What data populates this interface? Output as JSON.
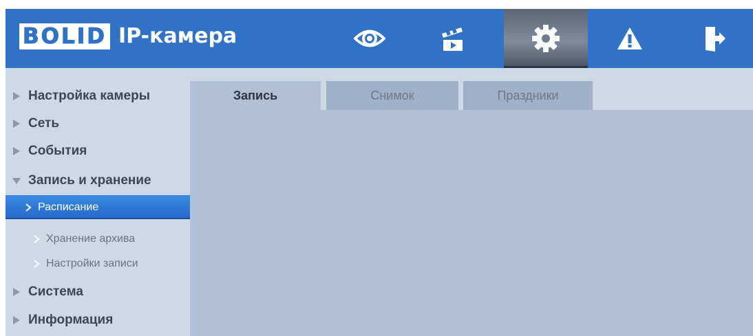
{
  "header": {
    "logo": "BOLID",
    "product": "IP-камера",
    "nav": [
      {
        "icon": "eye-icon",
        "label": "Просмотр"
      },
      {
        "icon": "clapperboard-icon",
        "label": "Воспроизведение"
      },
      {
        "icon": "gear-icon",
        "label": "Настройки",
        "active": true
      },
      {
        "icon": "warning-icon",
        "label": "Тревога"
      },
      {
        "icon": "logout-icon",
        "label": "Выход"
      }
    ]
  },
  "sidebar": {
    "items": [
      {
        "label": "Настройка камеры",
        "expanded": false
      },
      {
        "label": "Сеть",
        "expanded": false
      },
      {
        "label": "События",
        "expanded": false
      },
      {
        "label": "Запись и хранение",
        "expanded": true
      },
      {
        "label": "Система",
        "expanded": false
      },
      {
        "label": "Информация",
        "expanded": false
      }
    ],
    "subitems": [
      {
        "label": "Расписание",
        "active": true
      },
      {
        "label": "Хранение архива",
        "active": false
      },
      {
        "label": "Настройки записи",
        "active": false
      }
    ]
  },
  "tabs": [
    {
      "label": "Запись",
      "active": true
    },
    {
      "label": "Снимок",
      "active": false
    },
    {
      "label": "Праздники",
      "active": false
    }
  ],
  "colors": {
    "header": "#2f72c6",
    "sidebar": "#ced9e6",
    "content": "#afc0d7",
    "active_item": "#2468c9"
  }
}
